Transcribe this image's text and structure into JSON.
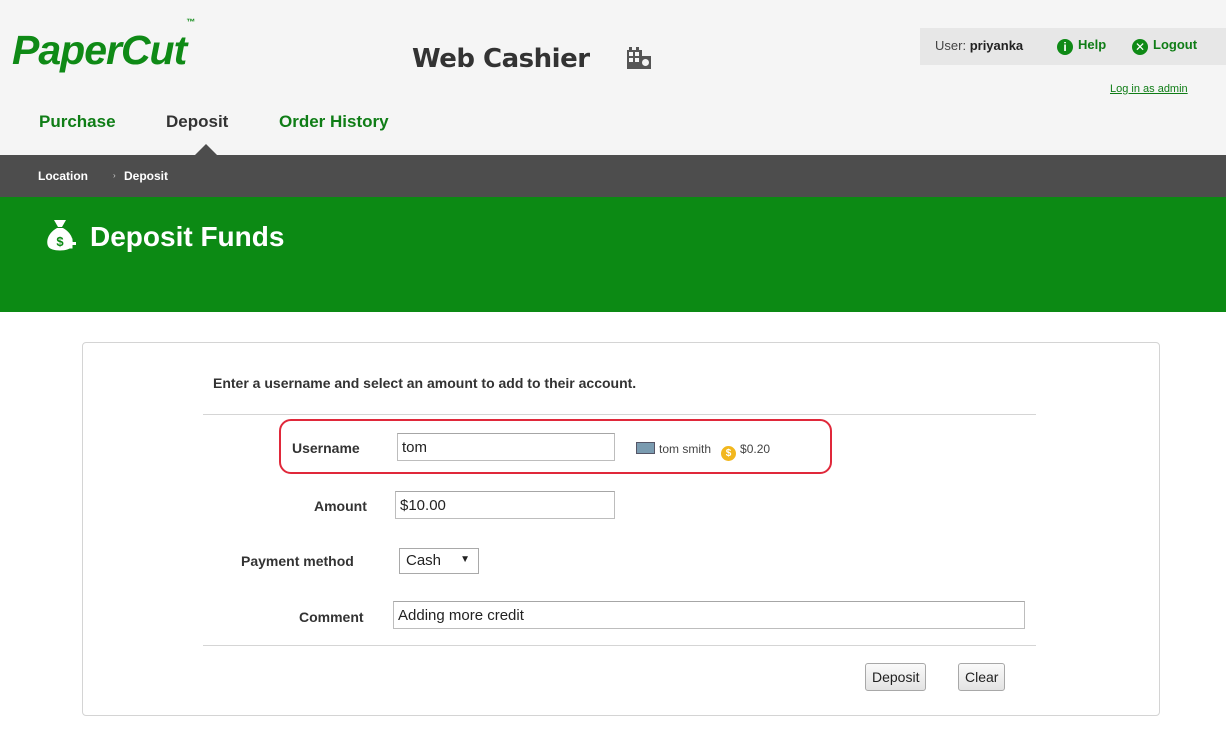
{
  "header": {
    "logo_text": "PaperCut",
    "logo_mark": "™",
    "app_title": "Web Cashier",
    "user_label": "User:",
    "user_name": "priyanka",
    "help_label": "Help",
    "logout_label": "Logout",
    "admin_link": "Log in as admin"
  },
  "nav": {
    "items": [
      {
        "label": "Purchase"
      },
      {
        "label": "Deposit"
      },
      {
        "label": "Order History"
      }
    ],
    "active": "Deposit"
  },
  "breadcrumb": {
    "items": [
      "Location",
      "Deposit"
    ],
    "separator": "›"
  },
  "banner": {
    "title": "Deposit Funds",
    "icon": "money-bag-plus-icon"
  },
  "form": {
    "instructions": "Enter a username and select an amount to add to their account.",
    "username": {
      "label": "Username",
      "value": "tom"
    },
    "user_lookup": {
      "full_name": "tom smith",
      "balance": "$0.20"
    },
    "amount": {
      "label": "Amount",
      "value": "$10.00"
    },
    "payment_method": {
      "label": "Payment method",
      "value": "Cash"
    },
    "comment": {
      "label": "Comment",
      "value": "Adding more credit"
    },
    "buttons": {
      "deposit": "Deposit",
      "clear": "Clear"
    }
  },
  "colors": {
    "brand_green": "#0c8a14",
    "link_green": "#0f7d16",
    "dark_bar": "#4d4d4d",
    "highlight_red": "#e0283a",
    "coin_gold": "#f2b71d"
  }
}
